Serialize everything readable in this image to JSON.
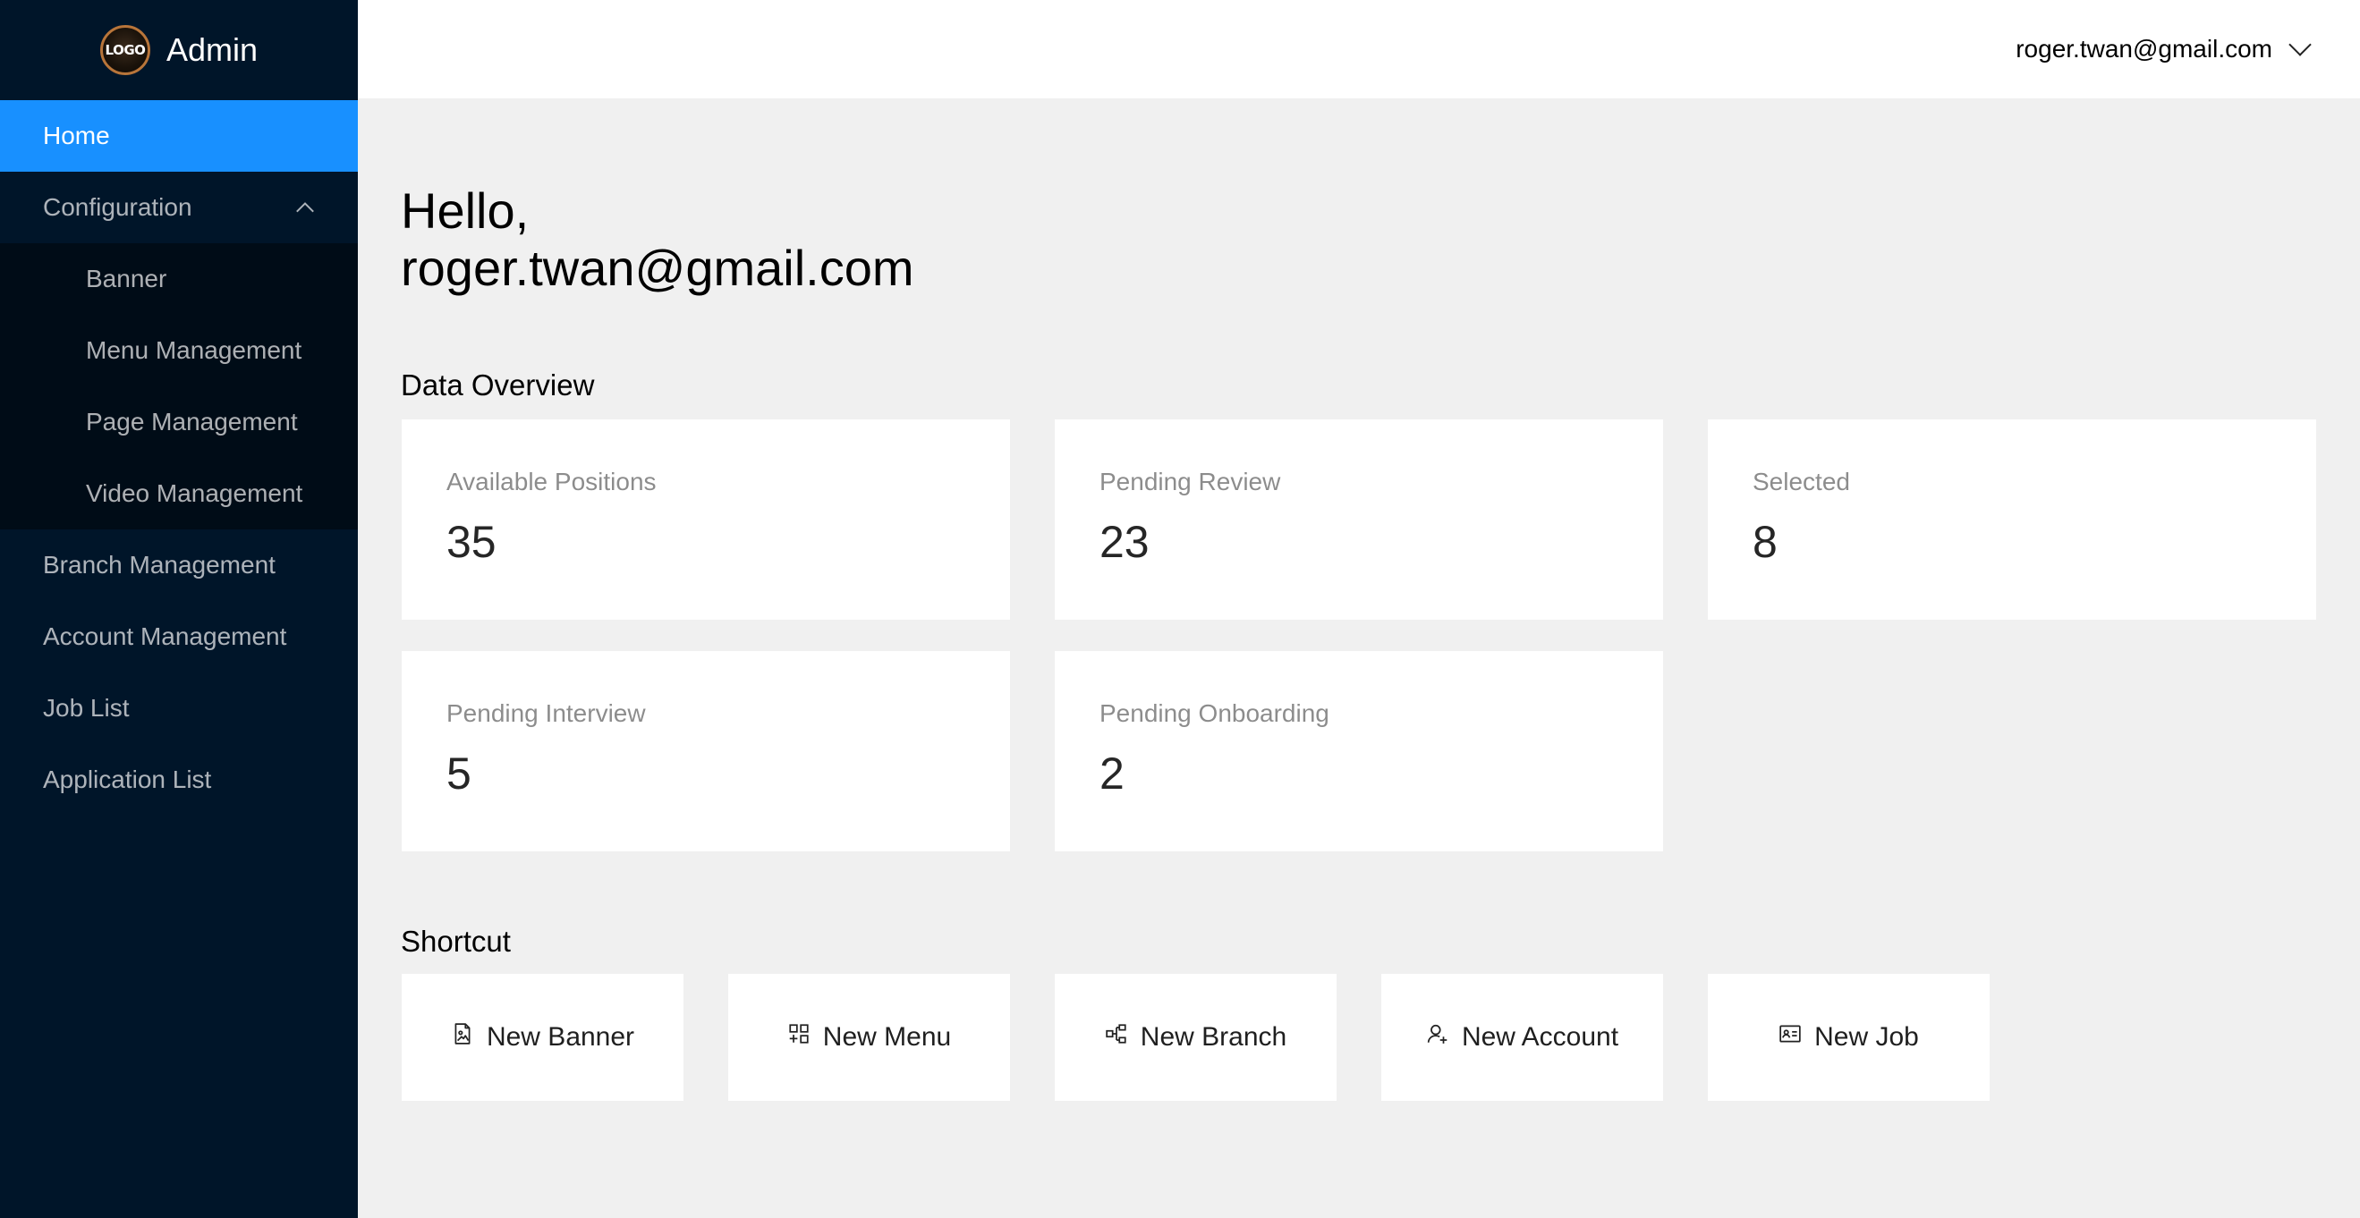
{
  "brand": {
    "logo_text": "LOGO",
    "title": "Admin"
  },
  "sidebar": {
    "home": "Home",
    "configuration": "Configuration",
    "config_items": [
      "Banner",
      "Menu Management",
      "Page Management",
      "Video Management"
    ],
    "items": [
      "Branch Management",
      "Account Management",
      "Job List",
      "Application List"
    ]
  },
  "header": {
    "user": "roger.twan@gmail.com"
  },
  "greeting": {
    "hello": "Hello,",
    "name": "roger.twan@gmail.com"
  },
  "overview": {
    "title": "Data Overview",
    "cards": [
      {
        "label": "Available Positions",
        "value": "35"
      },
      {
        "label": "Pending Review",
        "value": "23"
      },
      {
        "label": "Selected",
        "value": "8"
      },
      {
        "label": "Pending Interview",
        "value": "5"
      },
      {
        "label": "Pending Onboarding",
        "value": "2"
      }
    ]
  },
  "shortcut": {
    "title": "Shortcut",
    "items": [
      {
        "label": "New Banner",
        "icon": "file-image-icon"
      },
      {
        "label": "New Menu",
        "icon": "appstore-add-icon"
      },
      {
        "label": "New Branch",
        "icon": "cluster-icon"
      },
      {
        "label": "New Account",
        "icon": "user-add-icon"
      },
      {
        "label": "New Job",
        "icon": "idcard-icon"
      }
    ]
  },
  "colors": {
    "sidebar": "#001529",
    "submenu": "#000c17",
    "accent": "#1890ff",
    "content_bg": "#f0f0f0"
  }
}
